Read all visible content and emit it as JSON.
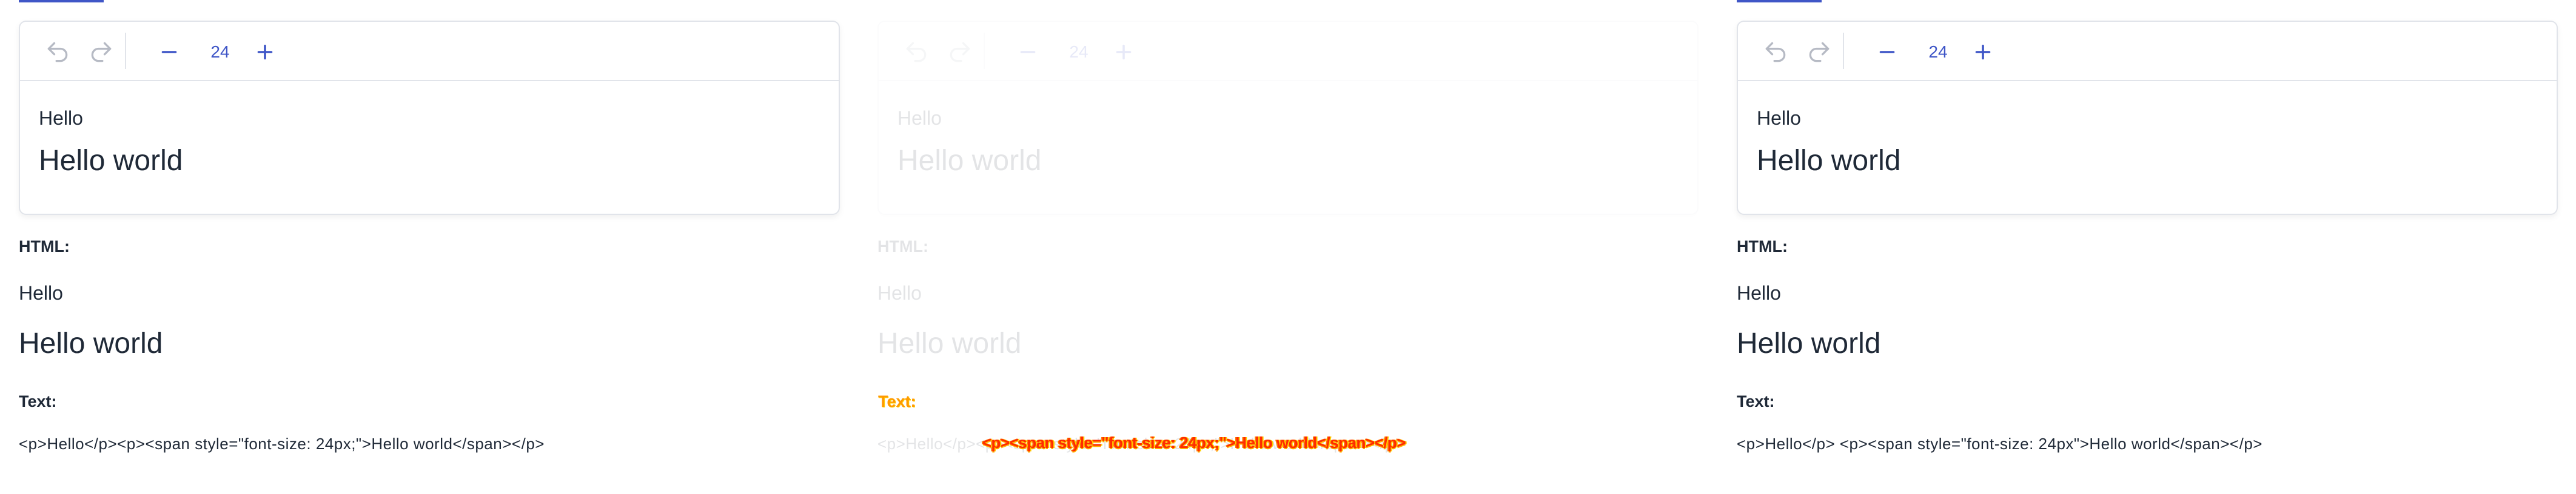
{
  "editor": {
    "toolbar": {
      "font_size": "24"
    },
    "content": {
      "p1": "Hello",
      "p2": "Hello world"
    }
  },
  "output": {
    "html_label": "HTML:",
    "html_p1": "Hello",
    "html_p2": "Hello world",
    "text_label": "Text:",
    "text_left": "<p>Hello</p><p><span style=\"font-size: 24px;\">Hello world</span></p>",
    "text_right": "<p>Hello</p> <p><span style=\"font-size: 24px\">Hello world</span></p>",
    "text_middle_glitch": "<p><span style=\"font-size: 24px;\">Hello world</span></p>"
  },
  "icons": [
    "undo-icon",
    "redo-icon",
    "minus-icon",
    "plus-icon"
  ],
  "colors": {
    "accent": "#3f56c7",
    "text": "#1f2937",
    "border": "#e1e4ea",
    "glitch": "#ff2b00"
  }
}
